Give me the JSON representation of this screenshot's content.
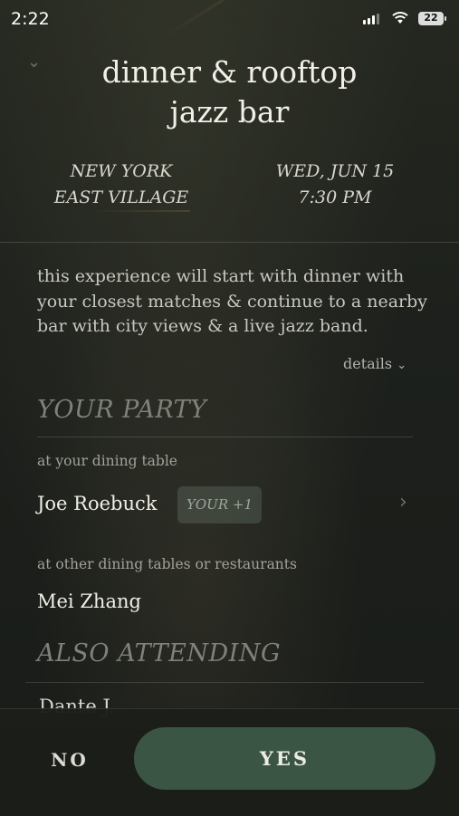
{
  "status_bar": {
    "time": "2:22",
    "battery": "22"
  },
  "header": {
    "title_line1": "dinner & rooftop",
    "title_line2": "jazz bar",
    "location_line1": "NEW YORK",
    "location_line2": "EAST VILLAGE",
    "date": "WED, JUN 15",
    "time": "7:30 PM"
  },
  "description": "this experience will start with dinner with your closest matches & continue to a nearby bar with city views & a live jazz band.",
  "details_label": "details",
  "party": {
    "heading": "YOUR PARTY",
    "table_label": "at your dining table",
    "table_member": "Joe Roebuck",
    "table_badge": "YOUR +1",
    "other_label": "at other dining tables or restaurants",
    "other_member": "Mei Zhang"
  },
  "also_attending": {
    "heading": "ALSO ATTENDING",
    "first_partial": "Dante J."
  },
  "actions": {
    "no_label": "NO",
    "yes_label": "YES"
  },
  "colors": {
    "accent_button": "#3b5544",
    "background": "#1b1e1a"
  }
}
